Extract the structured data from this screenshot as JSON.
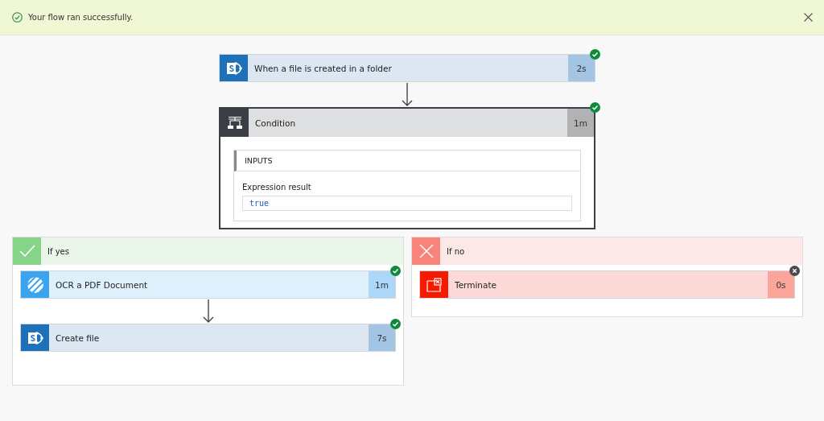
{
  "banner": {
    "message": "Your flow ran successfully.",
    "success": true
  },
  "trigger": {
    "kind": "sharepoint",
    "title": "When a file is created in a folder",
    "duration": "2s",
    "succeeded": true
  },
  "condition": {
    "title": "Condition",
    "duration": "1m",
    "succeeded": true,
    "inputs_heading": "INPUTS",
    "field_label": "Expression result",
    "field_value": "true"
  },
  "branches": [
    {
      "kind": "yes",
      "label": "If yes",
      "actions": [
        {
          "kind": "ocr",
          "title": "OCR a PDF Document",
          "duration": "1m",
          "succeeded": true
        },
        {
          "kind": "sharepoint",
          "title": "Create file",
          "duration": "7s",
          "succeeded": true
        }
      ]
    },
    {
      "kind": "no",
      "label": "If no",
      "actions": [
        {
          "kind": "terminate",
          "title": "Terminate",
          "duration": "0s",
          "succeeded": false
        }
      ]
    }
  ]
}
